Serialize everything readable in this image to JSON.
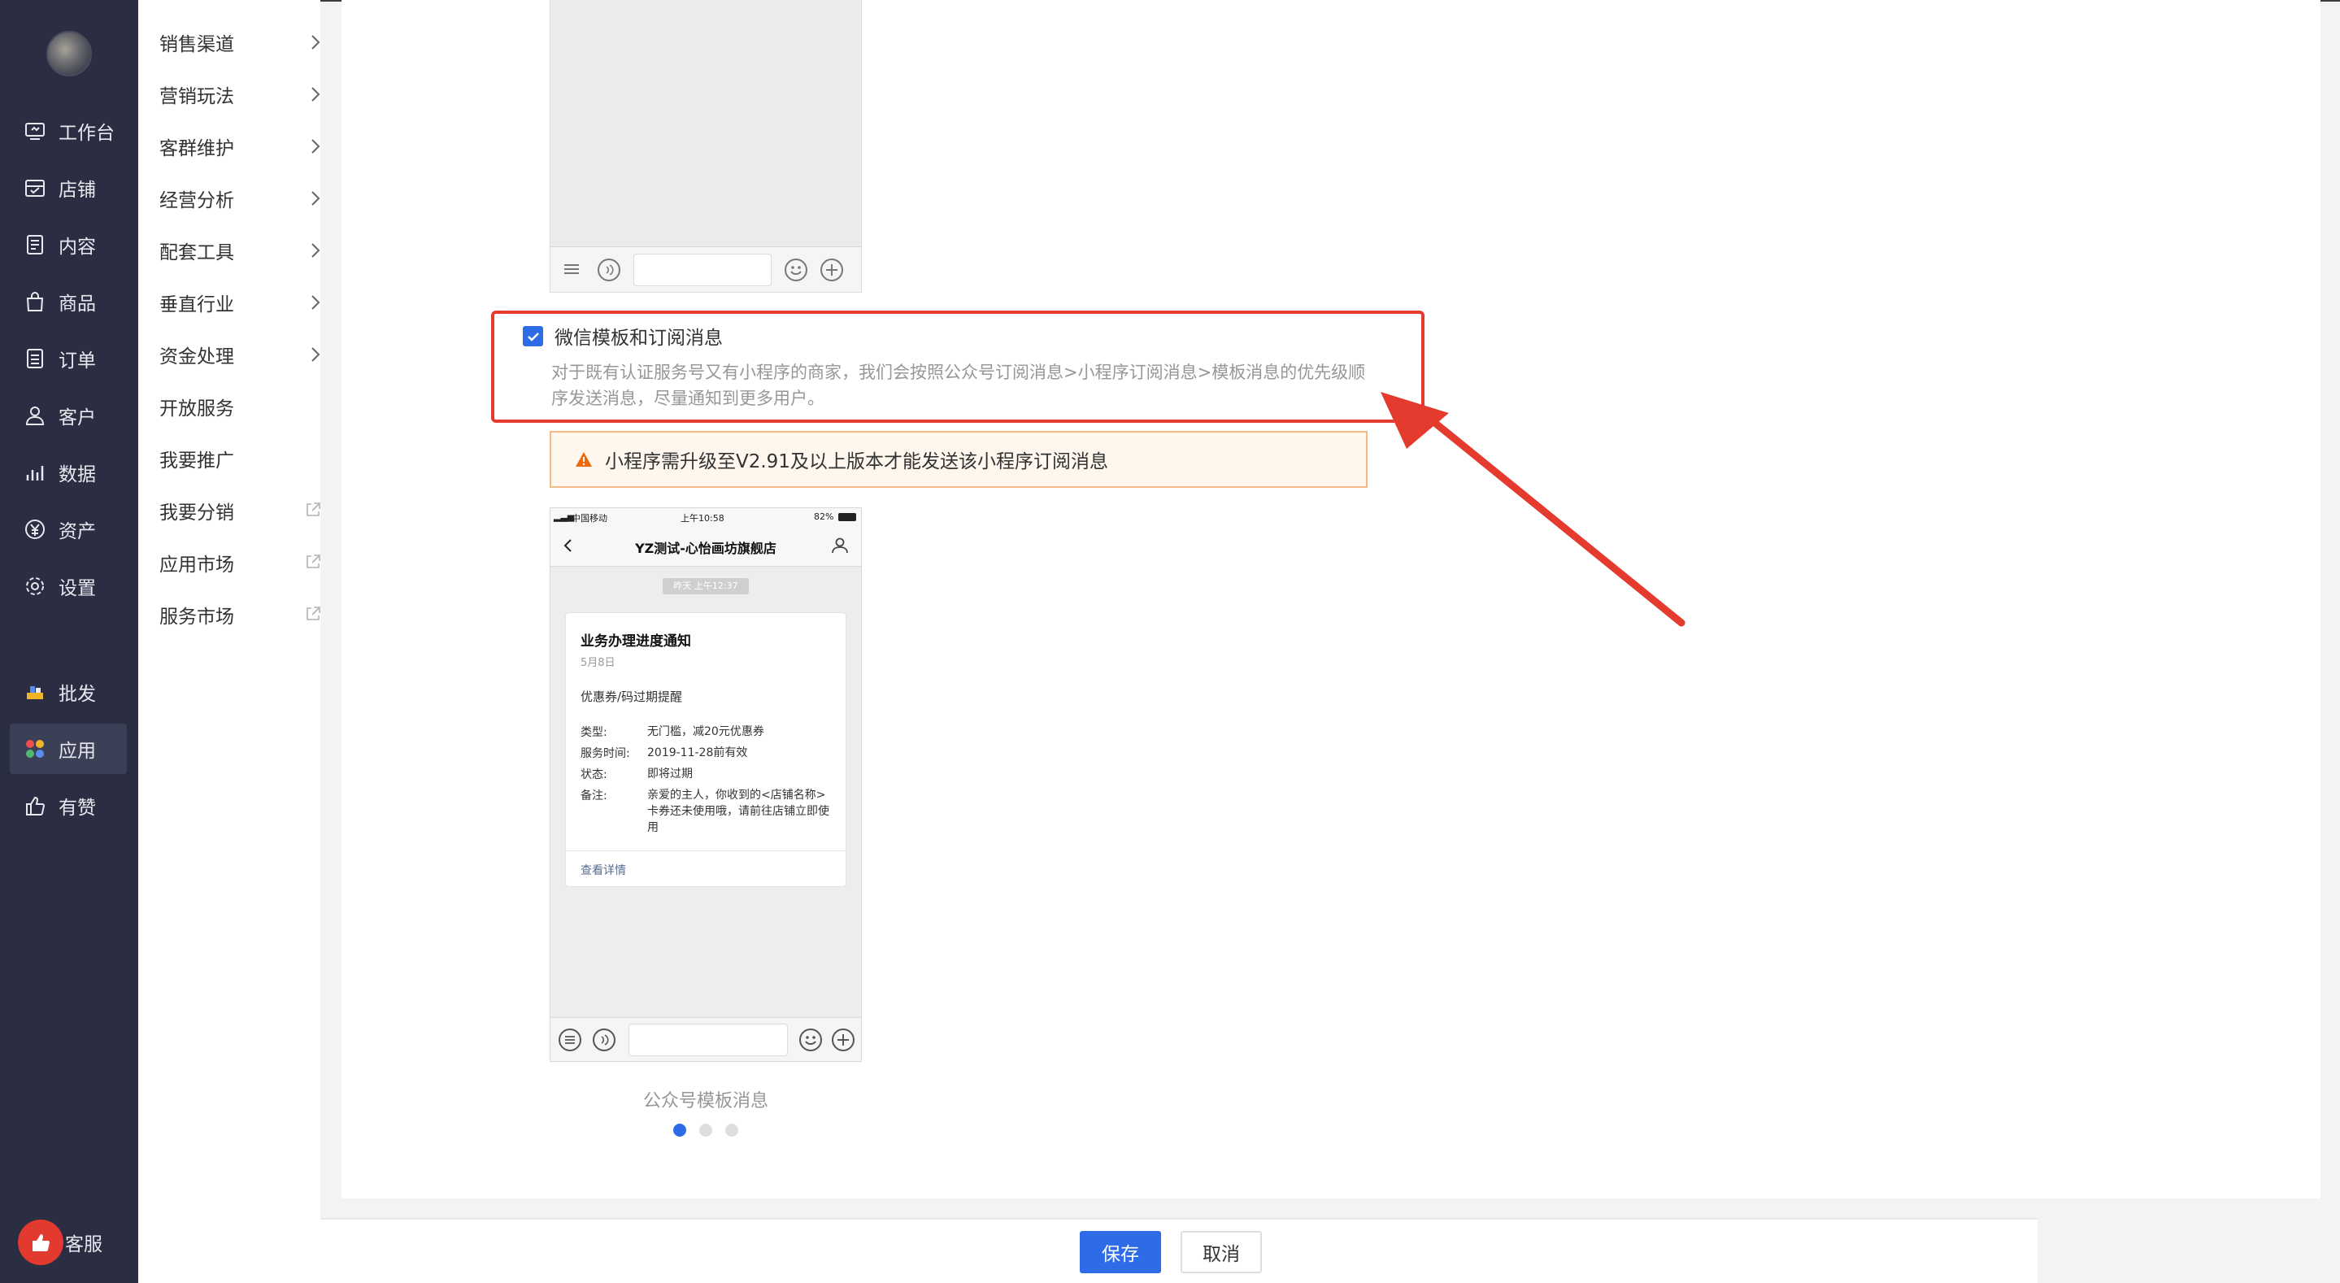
{
  "nav_primary": {
    "items": [
      {
        "label": "工作台",
        "icon": "dashboard-icon"
      },
      {
        "label": "店铺",
        "icon": "shop-icon"
      },
      {
        "label": "内容",
        "icon": "content-icon"
      },
      {
        "label": "商品",
        "icon": "bag-icon"
      },
      {
        "label": "订单",
        "icon": "order-icon"
      },
      {
        "label": "客户",
        "icon": "user-icon"
      },
      {
        "label": "数据",
        "icon": "chart-icon"
      },
      {
        "label": "资产",
        "icon": "yen-icon"
      },
      {
        "label": "设置",
        "icon": "gear-icon"
      }
    ],
    "extra_items": [
      {
        "label": "批发",
        "icon": "wholesale-icon"
      },
      {
        "label": "应用",
        "icon": "apps-icon",
        "active": true
      },
      {
        "label": "有赞",
        "icon": "thumb-icon"
      }
    ],
    "service_label": "客服"
  },
  "nav_secondary": {
    "items": [
      {
        "label": "销售渠道",
        "suffix": "chevron"
      },
      {
        "label": "营销玩法",
        "suffix": "chevron"
      },
      {
        "label": "客群维护",
        "suffix": "chevron"
      },
      {
        "label": "经营分析",
        "suffix": "chevron"
      },
      {
        "label": "配套工具",
        "suffix": "chevron"
      },
      {
        "label": "垂直行业",
        "suffix": "chevron"
      },
      {
        "label": "资金处理",
        "suffix": "chevron"
      },
      {
        "label": "开放服务",
        "suffix": "none"
      },
      {
        "label": "我要推广",
        "suffix": "none"
      },
      {
        "label": "我要分销",
        "suffix": "external"
      },
      {
        "label": "应用市场",
        "suffix": "external"
      },
      {
        "label": "服务市场",
        "suffix": "external"
      }
    ]
  },
  "option": {
    "checked": true,
    "label": "微信模板和订阅消息",
    "description": "对于既有认证服务号又有小程序的商家，我们会按照公众号订阅消息>小程序订阅消息>模板消息的优先级顺序发送消息，尽量通知到更多用户。"
  },
  "warning": {
    "text": "小程序需升级至V2.91及以上版本才能发送该小程序订阅消息"
  },
  "preview": {
    "status_carrier": "中国移动",
    "status_time": "上午10:58",
    "status_battery": "82%",
    "chat_title": "YZ测试-心怡画坊旗舰店",
    "time_pill": "昨天 上午12:37",
    "card": {
      "title": "业务办理进度通知",
      "date": "5月8日",
      "subtitle": "优惠券/码过期提醒",
      "rows": [
        {
          "k": "类型:",
          "v": "无门槛，减20元优惠券"
        },
        {
          "k": "服务时间:",
          "v": "2019-11-28前有效"
        },
        {
          "k": "状态:",
          "v": "即将过期"
        },
        {
          "k": "备注:",
          "v": "亲爱的主人，你收到的<店铺名称>卡券还未使用哦，请前往店铺立即使用"
        }
      ],
      "link": "查看详情"
    },
    "caption": "公众号模板消息",
    "pager": {
      "count": 3,
      "active": 0
    }
  },
  "footer": {
    "save_label": "保存",
    "cancel_label": "取消"
  },
  "colors": {
    "primary": "#2e6be6",
    "highlight": "#e53a2e",
    "nav_bg": "#2b2e42"
  }
}
